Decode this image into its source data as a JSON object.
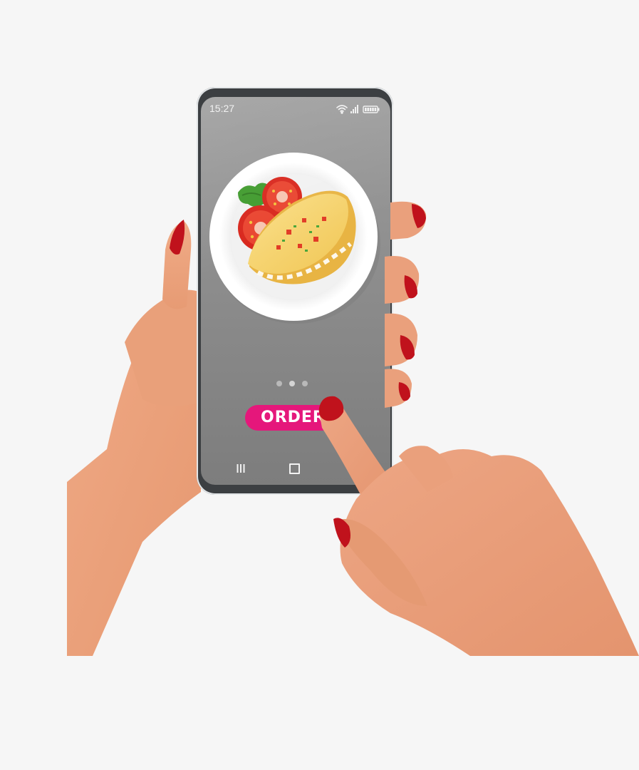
{
  "status_bar": {
    "time": "15:27",
    "icons": [
      "wifi-icon",
      "cellular-signal-icon",
      "battery-icon"
    ]
  },
  "food_card": {
    "image": "omelette-with-tomato-and-parsley-on-plate"
  },
  "pager": {
    "dot_count": 3,
    "active_index": 1
  },
  "order_button": {
    "label": "ORDER",
    "background": "#e5177b"
  },
  "nav_bar": {
    "icons": [
      "recent-apps-icon",
      "home-icon"
    ]
  },
  "colors": {
    "page_background": "#f6f6f6",
    "phone_frame": "#3c3f42",
    "screen": "#8f8f8f",
    "skin": "#eaa07c",
    "nail_polish": "#c0121c"
  }
}
